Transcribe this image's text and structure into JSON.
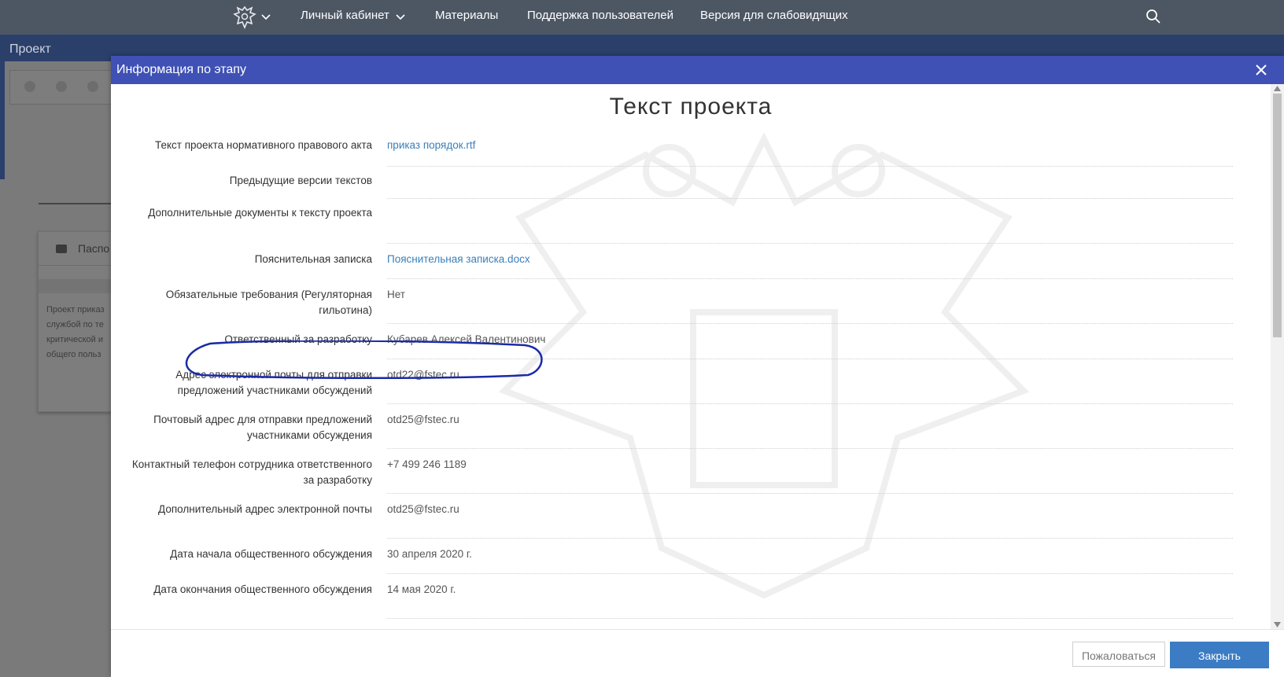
{
  "topnav": {
    "items": [
      {
        "label": "Личный кабинет",
        "has_dropdown": true
      },
      {
        "label": "Материалы",
        "has_dropdown": false
      },
      {
        "label": "Поддержка пользователей",
        "has_dropdown": false
      },
      {
        "label": "Версия для слабовидящих",
        "has_dropdown": false
      }
    ],
    "emblem_icon": "coat-of-arms-icon",
    "search_icon": "search-icon"
  },
  "background": {
    "header_title": "Проект",
    "card_title": "Паспо",
    "card_text": [
      "Проект приказ",
      "службой по те",
      "критической и",
      "общего польз"
    ]
  },
  "modal": {
    "title": "Информация по этапу",
    "section_title": "Текст проекта",
    "fields": [
      {
        "label": "Текст проекта нормативного правового акта",
        "value": "приказ порядок.rtf",
        "is_link": true
      },
      {
        "label": "Предыдущие версии текстов",
        "value": "",
        "is_link": false
      },
      {
        "label": "Дополнительные документы к тексту проекта",
        "value": "",
        "is_link": false
      },
      {
        "label": "Пояснительная записка",
        "value": "Пояснительная записка.docx",
        "is_link": true
      },
      {
        "label": "Обязательные требования (Регуляторная гильотина)",
        "value": "Нет",
        "is_link": false
      },
      {
        "label": "Ответственный за разработку",
        "value": "Кубарев Алексей Валентинович",
        "is_link": false
      },
      {
        "label": "Адрес электронной почты для отправки предложений участниками обсуждений",
        "value": "otd22@fstec.ru",
        "is_link": false
      },
      {
        "label": "Почтовый адрес для отправки предложений участниками обсуждения",
        "value": "otd25@fstec.ru",
        "is_link": false
      },
      {
        "label": "Контактный телефон сотрудника ответственного за разработку",
        "value": "+7 499 246 1189",
        "is_link": false
      },
      {
        "label": "Дополнительный адрес электронной почты",
        "value": "otd25@fstec.ru",
        "is_link": false
      },
      {
        "label": "Дата начала общественного обсуждения",
        "value": "30 апреля 2020 г.",
        "is_link": false
      },
      {
        "label": "Дата окончания общественного обсуждения",
        "value": "14 мая 2020 г.",
        "is_link": false
      }
    ],
    "buttons": {
      "complain": "Пожаловаться",
      "close": "Закрыть"
    }
  },
  "colors": {
    "topbar": "#4d5764",
    "modal_header": "#3f51b5",
    "link": "#3a7fb8",
    "primary_button": "#3b7cc4",
    "annotation": "#1a2aa8"
  }
}
